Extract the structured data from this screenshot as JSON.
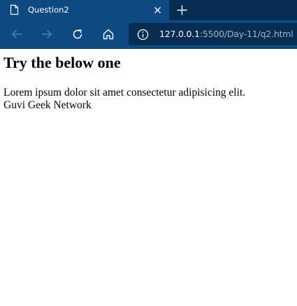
{
  "browser": {
    "tab": {
      "title": "Question2",
      "icon": "page-icon"
    },
    "toolbar": {
      "back_icon": "arrow-left-icon",
      "forward_icon": "arrow-right-icon",
      "refresh_icon": "refresh-icon",
      "home_icon": "home-icon",
      "info_icon": "info-icon"
    },
    "address": {
      "host": "127.0.0.1",
      "rest": ":5500/Day-11/q2.html"
    },
    "colors": {
      "tabstrip": "#062d52",
      "chrome": "#0e4a82",
      "address_bg": "#062d52"
    }
  },
  "page": {
    "heading": "Try the below one",
    "lines": [
      "Lorem ipsum dolor sit amet consectetur adipisicing elit.",
      "Guvi Geek Network"
    ]
  }
}
